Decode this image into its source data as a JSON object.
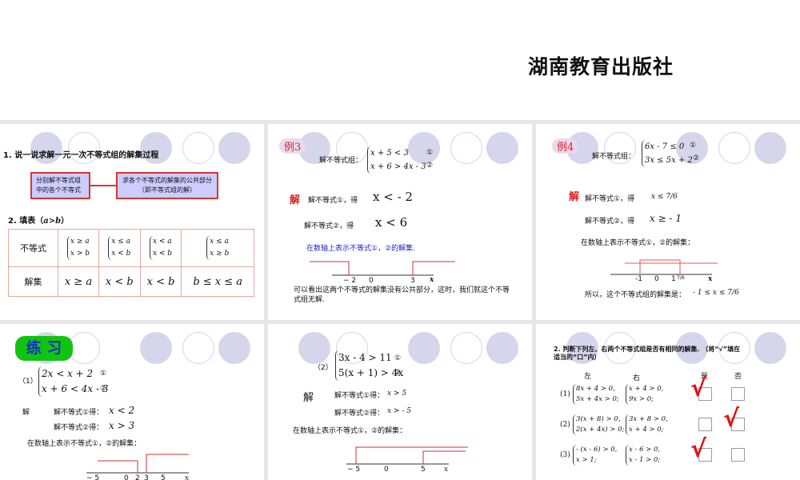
{
  "publisher": "湖南教育出版社",
  "slide1": {
    "q1": "1. 说一说求解一元一次不等式组的解集过程",
    "box1": "分别解不等式组中的各个不等式",
    "box2": "求各个不等式的解集的公共部分（即不等式组的解）",
    "q2": "2. 填表（",
    "q2_var": "a>b",
    "q2_end": "）",
    "row1_label": "不等式",
    "row2_label": "解集",
    "systems": [
      [
        "x ≥ a",
        "x > b"
      ],
      [
        "x ≤ a",
        "x < b"
      ],
      [
        "x < a",
        "x < b"
      ],
      [
        "x ≤ a",
        "x ≥ b"
      ]
    ],
    "answers": [
      "x ≥ a",
      "x < b",
      "x < b",
      "b ≤ x ≤ a"
    ]
  },
  "slide2": {
    "badge": "例3",
    "prompt": "解不等式组：",
    "eq1": "x + 5 < 3",
    "eq2": "x + 6 > 4x - 3",
    "n1": "①",
    "n2": "②",
    "jie": "解",
    "step1": "解不等式①，得",
    "res1": "x < - 2",
    "step2": "解不等式②，得",
    "res2": "x < 6",
    "blue": "在数轴上表示不等式①，②的解集.",
    "ticks": [
      "− 2",
      "0",
      "3",
      "x"
    ],
    "conclusion": "可以看出这两个不等式的解集没有公共部分，这时，我们就这个不等式组无解."
  },
  "slide3": {
    "badge": "例4",
    "prompt": "解不等式组：",
    "eq1": "6x - 7 ≤ 0",
    "eq2": "3x ≤ 5x + 2",
    "n1": "①",
    "n2": "②",
    "jie": "解",
    "step1": "解不等式①，得",
    "res1": "x ≤ 7/6",
    "step2": "解不等式②，得",
    "res2": "x ≥ - 1",
    "line": "在数轴上表示不等式①，②的解集：",
    "ticks": [
      "-1",
      "0",
      "1",
      "7/6",
      "x"
    ],
    "conclusion": "所以，这个不等式组的解集是：",
    "answer": "- 1 ≤ x ≤ 7/6"
  },
  "slide4": {
    "badge": "练 习",
    "label": "（1）",
    "eq1": "2x < x + 2",
    "eq2": "x + 6 < 4x - 3",
    "n1": "①",
    "n2": "②",
    "jie": "解",
    "step1": "解不等式①得：",
    "res1": "x < 2",
    "step2": "解不等式②得：",
    "res2": "x > 3",
    "line": "在数轴上表示不等式①，②的解集：",
    "ticks": [
      "− 5",
      "0",
      "2",
      "3",
      "5",
      "x"
    ]
  },
  "slide5": {
    "label": "（2）",
    "eq1": "3x - 4 > 11",
    "eq2": "5(x + 1) > 4x",
    "n1": "①",
    "n2": "②",
    "jie": "解",
    "step1": "解不等式①得：",
    "res1": "x > 5",
    "step2": "解不等式②得：",
    "res2": "x > - 5",
    "line": "在数轴上表示不等式①，②的解集：",
    "ticks": [
      "− 5",
      "0",
      "5",
      "x"
    ]
  },
  "slide6": {
    "title": "2. 判断下列左、右两个不等式组是否有相同的解集. （将“√”填在适当的“口”内）",
    "col_left": "左",
    "col_right": "右",
    "col_yes": "是",
    "col_no": "否",
    "rows": [
      {
        "n": "(1)",
        "left": [
          "8x + 4 > 0,",
          "5x + 4x > 0;"
        ],
        "right": [
          "x + 4 > 0,",
          "9x > 0;"
        ],
        "answer": "是"
      },
      {
        "n": "(2)",
        "left": [
          "3(x + 8) > 0,",
          "2(x + 4x) > 0;"
        ],
        "right": [
          "3x + 8 > 0,",
          "x + 4 > 0;"
        ],
        "answer": "否"
      },
      {
        "n": "(3)",
        "left": [
          "- (x - 6) > 0,",
          "x > 1;"
        ],
        "right": [
          "x - 6 > 0,",
          "x - 1 > 0;"
        ],
        "answer": "是"
      }
    ],
    "check": "√"
  }
}
